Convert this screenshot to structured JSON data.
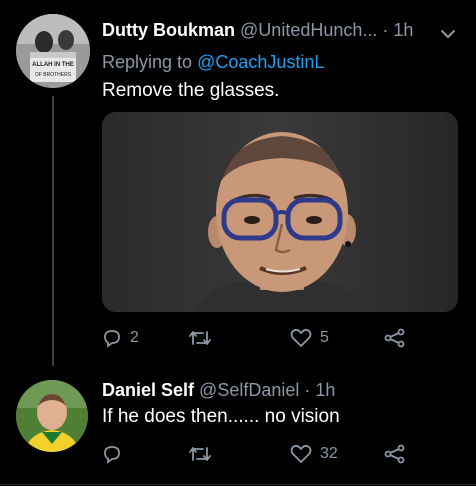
{
  "tweet1": {
    "name": "Dutty Boukman",
    "handle": "@UnitedHunch...",
    "separator": "·",
    "time": "1h",
    "replying_prefix": "Replying to",
    "replying_to": "@CoachJustinL",
    "text": "Remove the glasses.",
    "actions": {
      "replies": "2",
      "retweets": "",
      "likes": "5"
    },
    "avatar_poster_text": [
      "ALLAH IN THE",
      "OF BROTHERS"
    ]
  },
  "tweet2": {
    "name": "Daniel Self",
    "handle": "@SelfDaniel",
    "separator": "·",
    "time": "1h",
    "text": "If he does then...... no vision",
    "actions": {
      "replies": "",
      "retweets": "",
      "likes": "32"
    }
  },
  "colors": {
    "background": "#000000",
    "link": "#1da1f2",
    "muted": "#8b98a5",
    "thread_line": "#3a3f44"
  },
  "icons": {
    "reply": "comment-bubble-icon",
    "retweet": "retweet-arrows-icon",
    "like": "heart-icon",
    "share": "share-nodes-icon",
    "more": "chevron-down-icon"
  }
}
